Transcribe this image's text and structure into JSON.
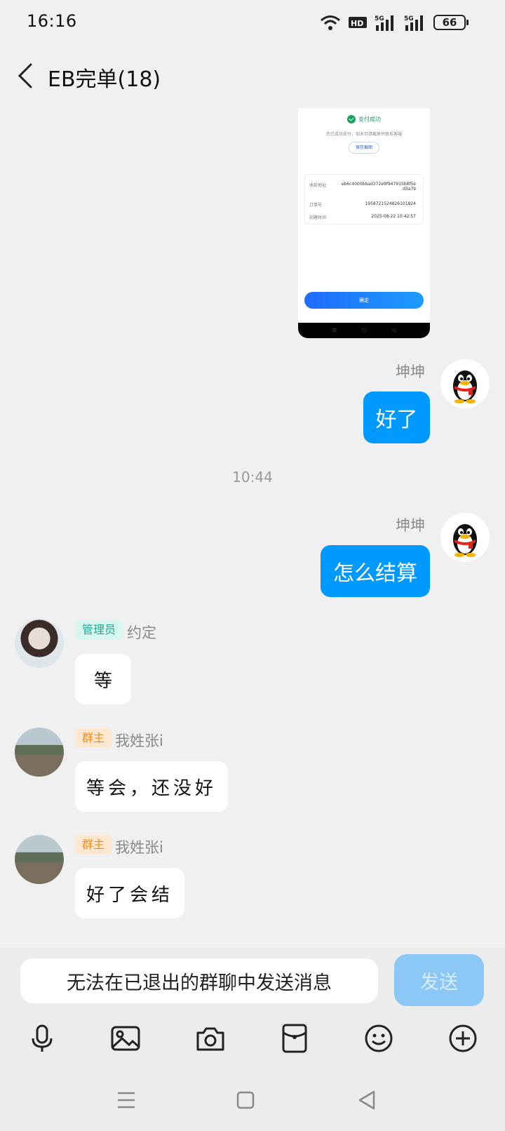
{
  "status_bar": {
    "time": "16:16",
    "battery": "66",
    "icons": [
      "wifi-icon",
      "hd-icon",
      "signal-5g-icon",
      "signal-5g-icon",
      "battery-icon"
    ]
  },
  "header": {
    "title": "EB完单(18)"
  },
  "image_message": {
    "status": "支付成功",
    "hint": "您已成功支付，如未到请截屏并联系客服",
    "save_label": "保存截图",
    "rows": [
      {
        "label": "收款地址",
        "value": "eb6c4000bbad372e9f947915b8f5e d3a79"
      },
      {
        "label": "订单号",
        "value": "1958721524826101824"
      },
      {
        "label": "创建时间",
        "value": "2025-08-22 10:42:57"
      }
    ],
    "confirm_label": "确定"
  },
  "messages": [
    {
      "sender": "坤坤",
      "text": "好了",
      "direction": "out"
    },
    {
      "separator": "10:44"
    },
    {
      "sender": "坤坤",
      "text": "怎么结算",
      "direction": "out"
    },
    {
      "role": "管理员",
      "sender": "约定",
      "text": "等",
      "direction": "in"
    },
    {
      "role": "群主",
      "sender": "我姓张i",
      "text": "等会，还没好",
      "direction": "in"
    },
    {
      "role": "群主",
      "sender": "我姓张i",
      "text": "好了会结",
      "direction": "in"
    }
  ],
  "input": {
    "disabled_text": "无法在已退出的群聊中发送消息",
    "send_label": "发送"
  },
  "toolbar": [
    "microphone-icon",
    "image-icon",
    "camera-icon",
    "red-packet-icon",
    "emoji-icon",
    "plus-icon"
  ],
  "colors": {
    "bubble_out": "#0099ff",
    "send_disabled": "#8cc8f5",
    "admin_badge": "#23a98c",
    "owner_badge": "#f08a1c"
  }
}
